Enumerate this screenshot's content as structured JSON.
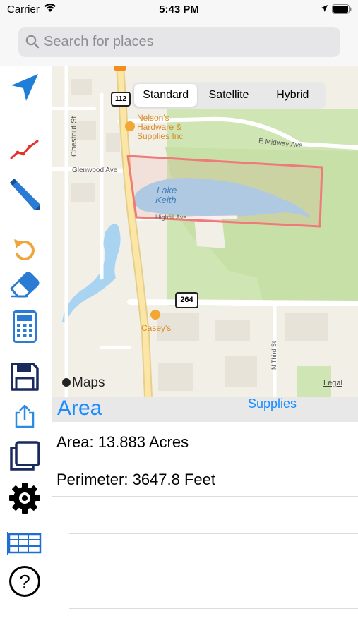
{
  "status_bar": {
    "carrier": "Carrier",
    "time": "5:43 PM"
  },
  "search": {
    "placeholder": "Search for places"
  },
  "sidebar": {
    "tools": [
      {
        "name": "location-arrow-icon"
      },
      {
        "name": "trend-line-icon"
      },
      {
        "name": "pencil-icon"
      },
      {
        "name": "undo-icon"
      },
      {
        "name": "eraser-icon"
      },
      {
        "name": "calculator-icon"
      },
      {
        "name": "save-icon"
      },
      {
        "name": "share-icon"
      },
      {
        "name": "copy-icon"
      },
      {
        "name": "settings-gear-icon"
      },
      {
        "name": "table-icon"
      },
      {
        "name": "help-icon"
      }
    ]
  },
  "map": {
    "map_type_segments": [
      "Standard",
      "Satellite",
      "Hybrid"
    ],
    "selected_segment": "Standard",
    "labels": {
      "business1": "Nelson's",
      "business2": "Hardware &",
      "business3": "Supplies Inc",
      "street_chestnut": "Chestnut St",
      "street_glenwood": "Glenwood Ave",
      "street_midway": "E Midway Ave",
      "lake1": "Lake",
      "lake2": "Keith",
      "street_highfill": "Highfill Ave",
      "route_112": "112",
      "route_264": "264",
      "store": "Casey's",
      "street_third": "N Third St",
      "maps_brand": "Maps",
      "legal": "Legal"
    },
    "colors": {
      "land": "#f2efe7",
      "park": "#cfe6b4",
      "water": "#a8d4f2",
      "road": "#ffffff",
      "highway": "#fbe6a6",
      "polygon": "#f07a7a"
    }
  },
  "results": {
    "title": "Area",
    "supplies_link": "Supplies",
    "area_text": "Area: 13.883 Acres",
    "perimeter_text": "Perimeter: 3647.8 Feet"
  }
}
